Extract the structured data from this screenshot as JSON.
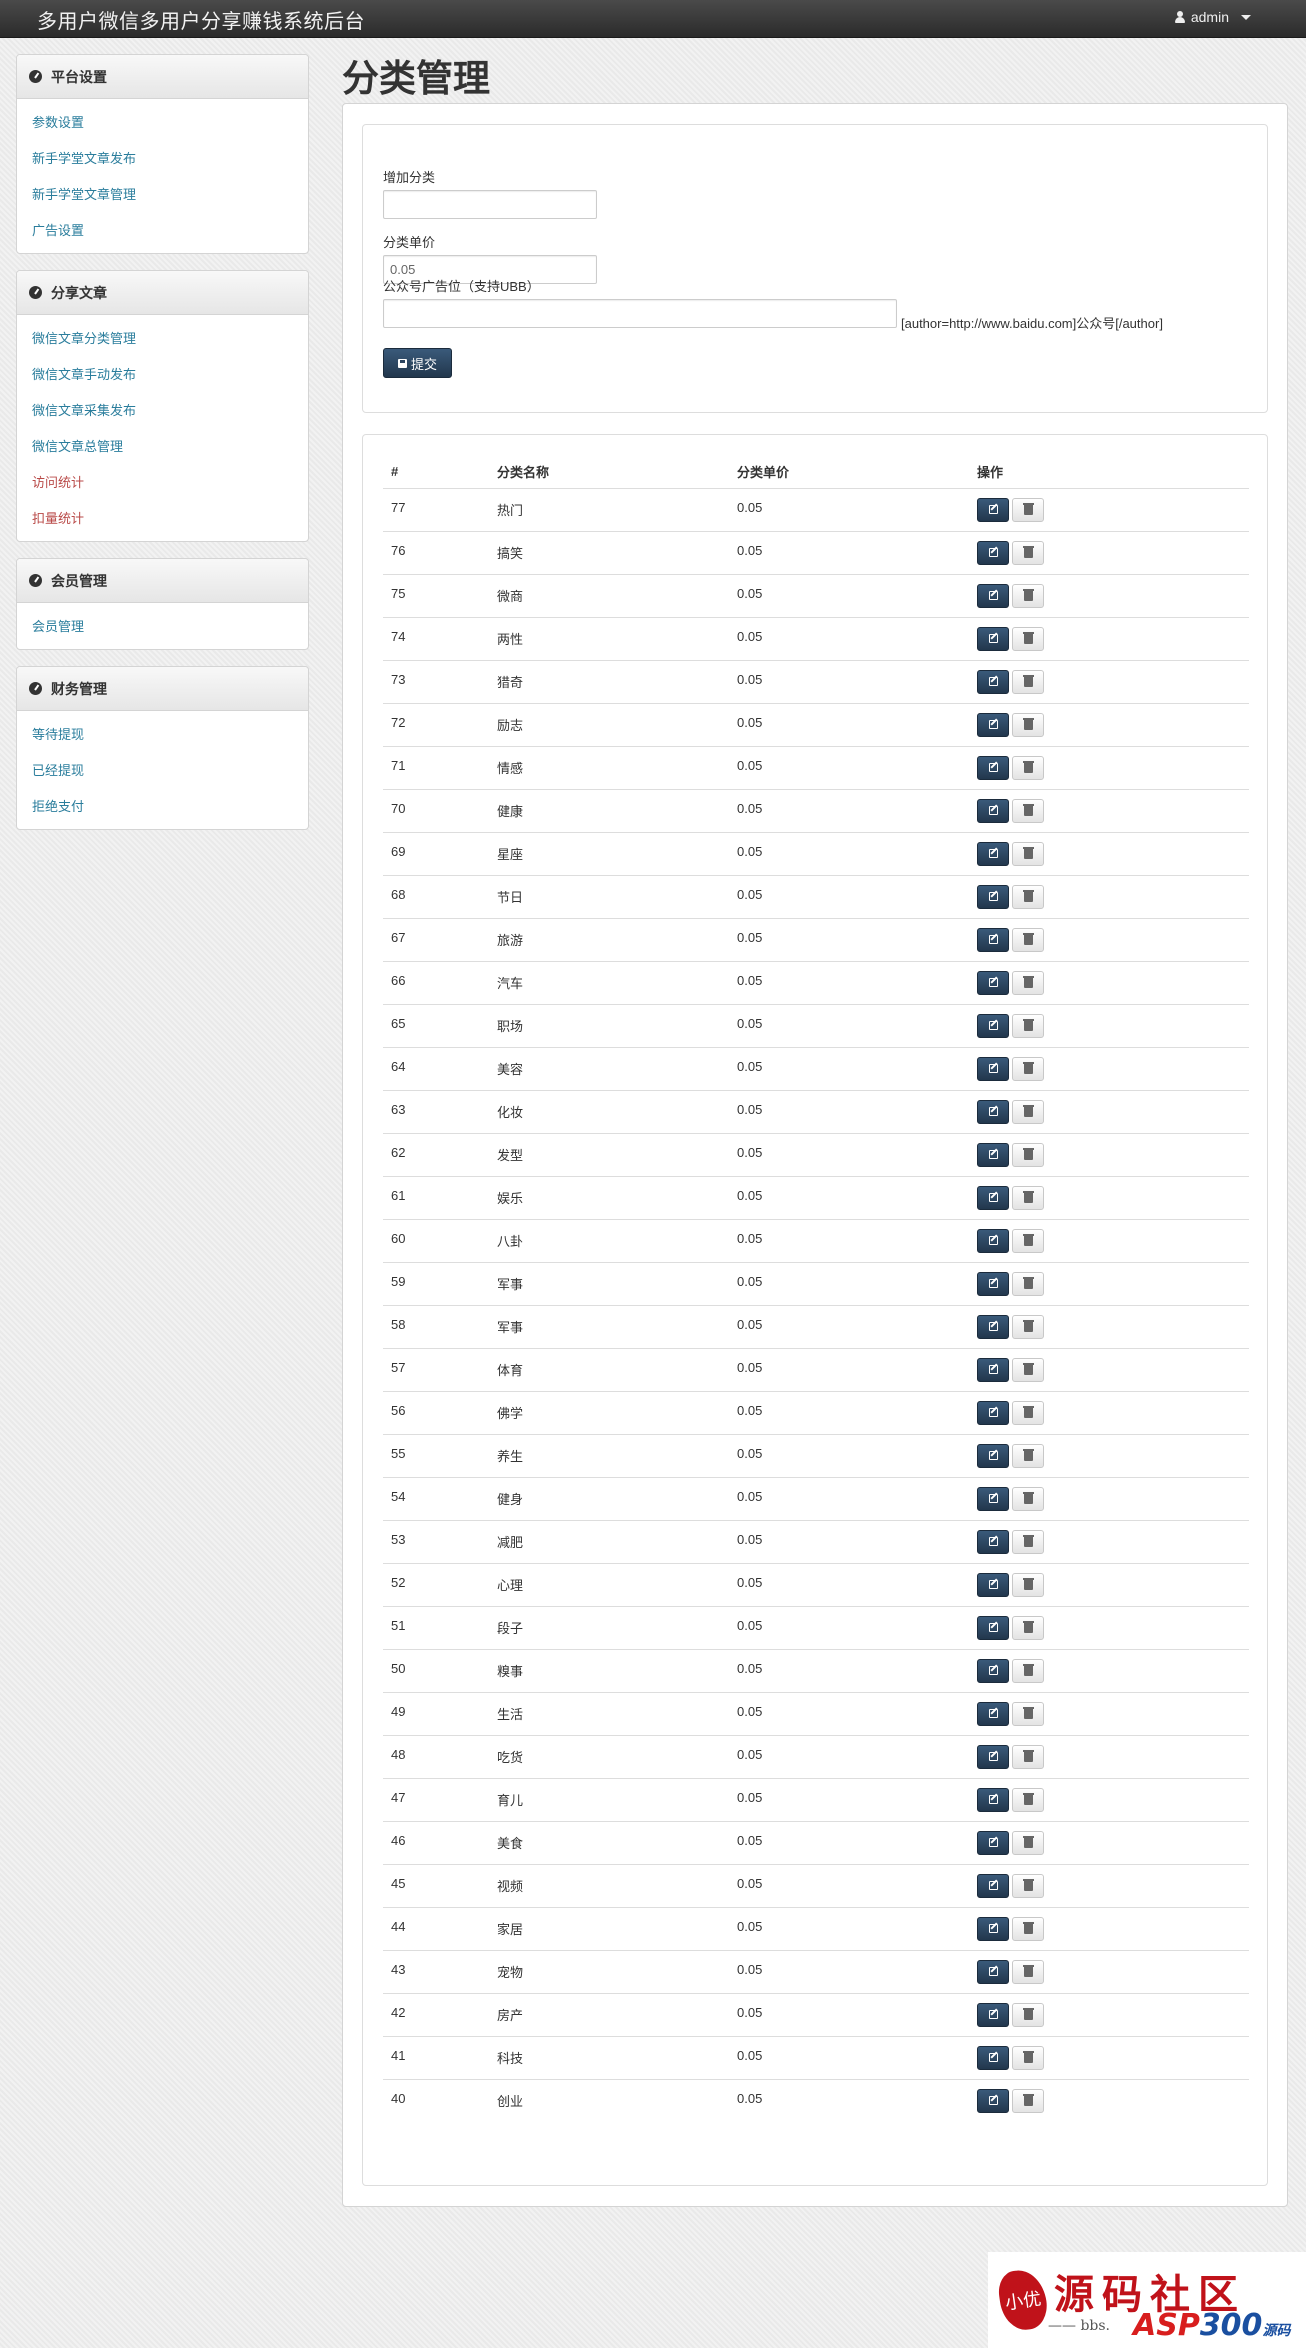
{
  "app": {
    "title": "多用户微信多用户分享赚钱系统后台",
    "user": "admin"
  },
  "sidebar": [
    {
      "heading": "平台设置",
      "items": [
        {
          "label": "参数设置",
          "danger": false
        },
        {
          "label": "新手学堂文章发布",
          "danger": false
        },
        {
          "label": "新手学堂文章管理",
          "danger": false
        },
        {
          "label": "广告设置",
          "danger": false
        }
      ]
    },
    {
      "heading": "分享文章",
      "items": [
        {
          "label": "微信文章分类管理",
          "danger": false
        },
        {
          "label": "微信文章手动发布",
          "danger": false
        },
        {
          "label": "微信文章采集发布",
          "danger": false
        },
        {
          "label": "微信文章总管理",
          "danger": false
        },
        {
          "label": "访问统计",
          "danger": true
        },
        {
          "label": "扣量统计",
          "danger": true
        }
      ]
    },
    {
      "heading": "会员管理",
      "items": [
        {
          "label": "会员管理",
          "danger": false
        }
      ]
    },
    {
      "heading": "财务管理",
      "items": [
        {
          "label": "等待提现",
          "danger": false
        },
        {
          "label": "已经提现",
          "danger": false
        },
        {
          "label": "拒绝支付",
          "danger": false
        }
      ]
    }
  ],
  "page": {
    "title": "分类管理"
  },
  "form": {
    "add_label": "增加分类",
    "add_value": "",
    "price_label": "分类单价",
    "price_value": "0.05",
    "ad_label": "公众号广告位（支持UBB）",
    "ad_value": "",
    "ad_hint": "[author=http://www.baidu.com]公众号[/author]",
    "submit_label": "提交"
  },
  "table": {
    "headers": [
      "#",
      "分类名称",
      "分类单价",
      "操作"
    ],
    "rows": [
      {
        "id": "77",
        "name": "热门",
        "price": "0.05"
      },
      {
        "id": "76",
        "name": "搞笑",
        "price": "0.05"
      },
      {
        "id": "75",
        "name": "微商",
        "price": "0.05"
      },
      {
        "id": "74",
        "name": "两性",
        "price": "0.05"
      },
      {
        "id": "73",
        "name": "猎奇",
        "price": "0.05"
      },
      {
        "id": "72",
        "name": "励志",
        "price": "0.05"
      },
      {
        "id": "71",
        "name": "情感",
        "price": "0.05"
      },
      {
        "id": "70",
        "name": "健康",
        "price": "0.05"
      },
      {
        "id": "69",
        "name": "星座",
        "price": "0.05"
      },
      {
        "id": "68",
        "name": "节日",
        "price": "0.05"
      },
      {
        "id": "67",
        "name": "旅游",
        "price": "0.05"
      },
      {
        "id": "66",
        "name": "汽车",
        "price": "0.05"
      },
      {
        "id": "65",
        "name": "职场",
        "price": "0.05"
      },
      {
        "id": "64",
        "name": "美容",
        "price": "0.05"
      },
      {
        "id": "63",
        "name": "化妆",
        "price": "0.05"
      },
      {
        "id": "62",
        "name": "发型",
        "price": "0.05"
      },
      {
        "id": "61",
        "name": "娱乐",
        "price": "0.05"
      },
      {
        "id": "60",
        "name": "八卦",
        "price": "0.05"
      },
      {
        "id": "59",
        "name": "军事",
        "price": "0.05"
      },
      {
        "id": "58",
        "name": "军事",
        "price": "0.05"
      },
      {
        "id": "57",
        "name": "体育",
        "price": "0.05"
      },
      {
        "id": "56",
        "name": "佛学",
        "price": "0.05"
      },
      {
        "id": "55",
        "name": "养生",
        "price": "0.05"
      },
      {
        "id": "54",
        "name": "健身",
        "price": "0.05"
      },
      {
        "id": "53",
        "name": "减肥",
        "price": "0.05"
      },
      {
        "id": "52",
        "name": "心理",
        "price": "0.05"
      },
      {
        "id": "51",
        "name": "段子",
        "price": "0.05"
      },
      {
        "id": "50",
        "name": "糗事",
        "price": "0.05"
      },
      {
        "id": "49",
        "name": "生活",
        "price": "0.05"
      },
      {
        "id": "48",
        "name": "吃货",
        "price": "0.05"
      },
      {
        "id": "47",
        "name": "育儿",
        "price": "0.05"
      },
      {
        "id": "46",
        "name": "美食",
        "price": "0.05"
      },
      {
        "id": "45",
        "name": "视频",
        "price": "0.05"
      },
      {
        "id": "44",
        "name": "家居",
        "price": "0.05"
      },
      {
        "id": "43",
        "name": "宠物",
        "price": "0.05"
      },
      {
        "id": "42",
        "name": "房产",
        "price": "0.05"
      },
      {
        "id": "41",
        "name": "科技",
        "price": "0.05"
      },
      {
        "id": "40",
        "name": "创业",
        "price": "0.05"
      }
    ]
  },
  "watermark": {
    "seal": "小优",
    "text": "源码社区",
    "sub": "—— bbs.",
    "logo_a": "ASP",
    "logo_b": "300",
    "logo_c": "源码"
  },
  "colors": {
    "link": "#2a7d9c",
    "danger_link": "#b94a48",
    "primary_button": "#2d4560"
  }
}
